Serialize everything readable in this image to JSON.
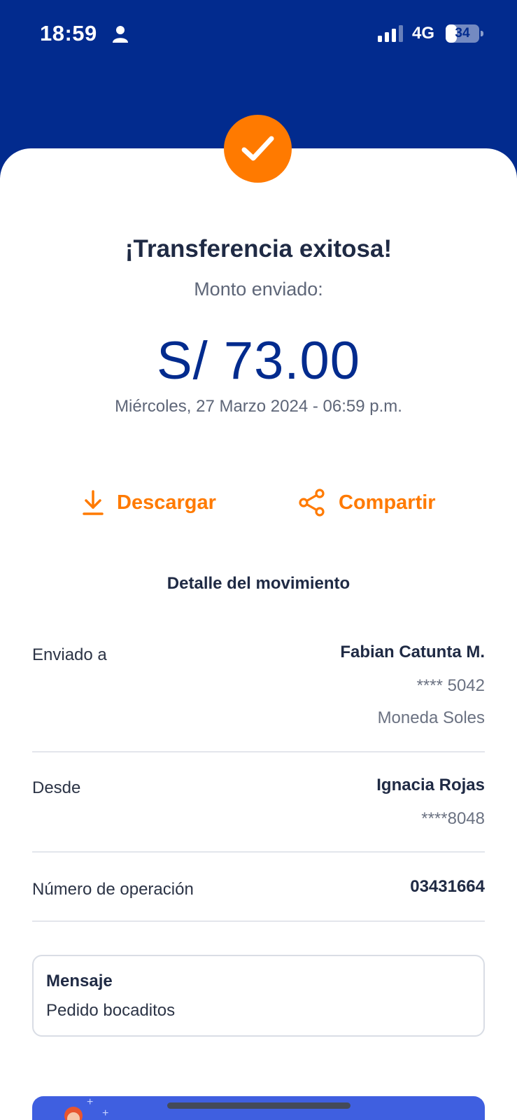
{
  "status_bar": {
    "time": "18:59",
    "network": "4G",
    "battery": "34",
    "battery_level": 0.34,
    "icons": [
      "person-icon",
      "signal-icon",
      "battery-icon"
    ]
  },
  "result": {
    "icon": "checkmark-icon",
    "title": "¡Transferencia exitosa!",
    "subtitle": "Monto enviado:",
    "amount": "S/ 73.00",
    "datetime": "Miércoles, 27 Marzo 2024 - 06:59 p.m."
  },
  "actions": {
    "download": {
      "label": "Descargar",
      "icon": "download-icon"
    },
    "share": {
      "label": "Compartir",
      "icon": "share-icon"
    }
  },
  "detail": {
    "title": "Detalle del movimiento",
    "sent_to": {
      "label": "Enviado a",
      "name": "Fabian Catunta M.",
      "account": "**** 5042",
      "currency": "Moneda Soles"
    },
    "from": {
      "label": "Desde",
      "name": "Ignacia Rojas",
      "account": "****8048"
    },
    "operation": {
      "label": "Número de operación",
      "value": "03431664"
    }
  },
  "message": {
    "title": "Mensaje",
    "text": "Pedido bocaditos"
  },
  "colors": {
    "header_blue": "#022b8e",
    "accent_orange": "#ff7a00",
    "banner_blue": "#3f5fe0"
  }
}
